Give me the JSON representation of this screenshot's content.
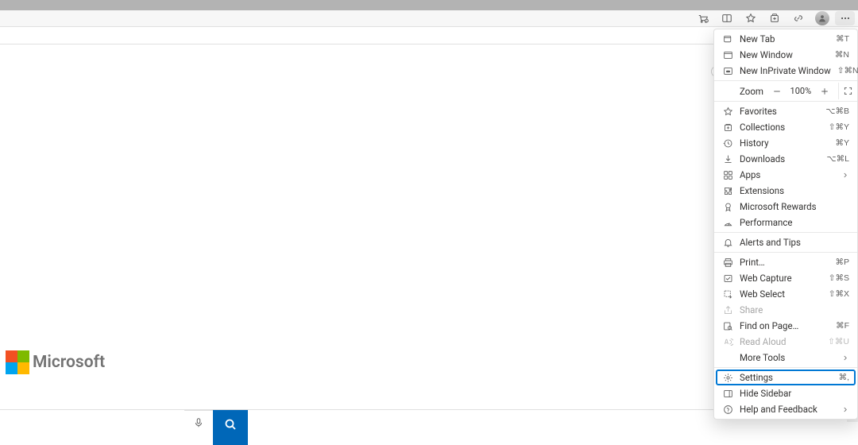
{
  "toolbar": {
    "icons": {
      "shopping": "shopping-icon",
      "split": "split-screen-icon",
      "favorites": "star-icon",
      "collections": "collections-icon",
      "share": "share-icon"
    }
  },
  "logo": {
    "text": "Microsoft"
  },
  "menu": {
    "new_tab": {
      "label": "New Tab",
      "shortcut": "⌘T"
    },
    "new_window": {
      "label": "New Window",
      "shortcut": "⌘N"
    },
    "new_inprivate": {
      "label": "New InPrivate Window",
      "shortcut": "⇧⌘N"
    },
    "zoom": {
      "label": "Zoom",
      "value": "100%"
    },
    "favorites": {
      "label": "Favorites",
      "shortcut": "⌥⌘B"
    },
    "collections": {
      "label": "Collections",
      "shortcut": "⇧⌘Y"
    },
    "history": {
      "label": "History",
      "shortcut": "⌘Y"
    },
    "downloads": {
      "label": "Downloads",
      "shortcut": "⌥⌘L"
    },
    "apps": {
      "label": "Apps"
    },
    "extensions": {
      "label": "Extensions"
    },
    "rewards": {
      "label": "Microsoft Rewards"
    },
    "performance": {
      "label": "Performance"
    },
    "alerts": {
      "label": "Alerts and Tips"
    },
    "print": {
      "label": "Print…",
      "shortcut": "⌘P"
    },
    "web_capture": {
      "label": "Web Capture",
      "shortcut": "⇧⌘S"
    },
    "web_select": {
      "label": "Web Select",
      "shortcut": "⇧⌘X"
    },
    "share": {
      "label": "Share"
    },
    "find": {
      "label": "Find on Page…",
      "shortcut": "⌘F"
    },
    "read_aloud": {
      "label": "Read Aloud",
      "shortcut": "⇧⌘U"
    },
    "more_tools": {
      "label": "More Tools"
    },
    "settings": {
      "label": "Settings",
      "shortcut": "⌘,"
    },
    "hide_sidebar": {
      "label": "Hide Sidebar"
    },
    "help": {
      "label": "Help and Feedback"
    }
  }
}
